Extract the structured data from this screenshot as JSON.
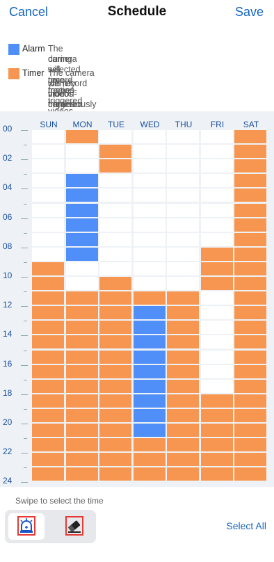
{
  "header": {
    "cancel_label": "Cancel",
    "title": "Schedule",
    "save_label": "Save"
  },
  "legend": [
    {
      "name": "Alarm",
      "color": "#4f8ff7",
      "desc_lines": [
        "The camera will record motion-triggered videos",
        "during selected time frames."
      ]
    },
    {
      "name": "Timer",
      "color": "#f79650",
      "desc_lines": [
        "The camera will record videos continuously and",
        "identify motion-triggered footage during selected",
        "time frames."
      ]
    }
  ],
  "days": [
    "SUN",
    "MON",
    "TUE",
    "WED",
    "THU",
    "FRI",
    "SAT"
  ],
  "hour_labels": [
    "00",
    "02",
    "04",
    "06",
    "08",
    "10",
    "12",
    "14",
    "16",
    "18",
    "20",
    "22",
    "24"
  ],
  "schedule": {
    "SUN": [
      {
        "type": "timer",
        "start": 9,
        "end": 24
      }
    ],
    "MON": [
      {
        "type": "timer",
        "start": 0,
        "end": 1
      },
      {
        "type": "alarm",
        "start": 3,
        "end": 9
      },
      {
        "type": "timer",
        "start": 11,
        "end": 24
      }
    ],
    "TUE": [
      {
        "type": "timer",
        "start": 1,
        "end": 3
      },
      {
        "type": "timer",
        "start": 10,
        "end": 24
      }
    ],
    "WED": [
      {
        "type": "timer",
        "start": 11,
        "end": 12
      },
      {
        "type": "alarm",
        "start": 12,
        "end": 21
      },
      {
        "type": "timer",
        "start": 21,
        "end": 24
      }
    ],
    "THU": [
      {
        "type": "timer",
        "start": 11,
        "end": 24
      }
    ],
    "FRI": [
      {
        "type": "timer",
        "start": 8,
        "end": 11
      },
      {
        "type": "timer",
        "start": 18,
        "end": 24
      }
    ],
    "SAT": [
      {
        "type": "timer",
        "start": 0,
        "end": 24
      }
    ]
  },
  "hint": "Swipe to select the time",
  "tools": [
    {
      "name": "alarm-tool",
      "icon": "alarm-siren-icon",
      "selected": true
    },
    {
      "name": "eraser-tool",
      "icon": "eraser-icon",
      "selected": false
    }
  ],
  "select_all_label": "Select All"
}
